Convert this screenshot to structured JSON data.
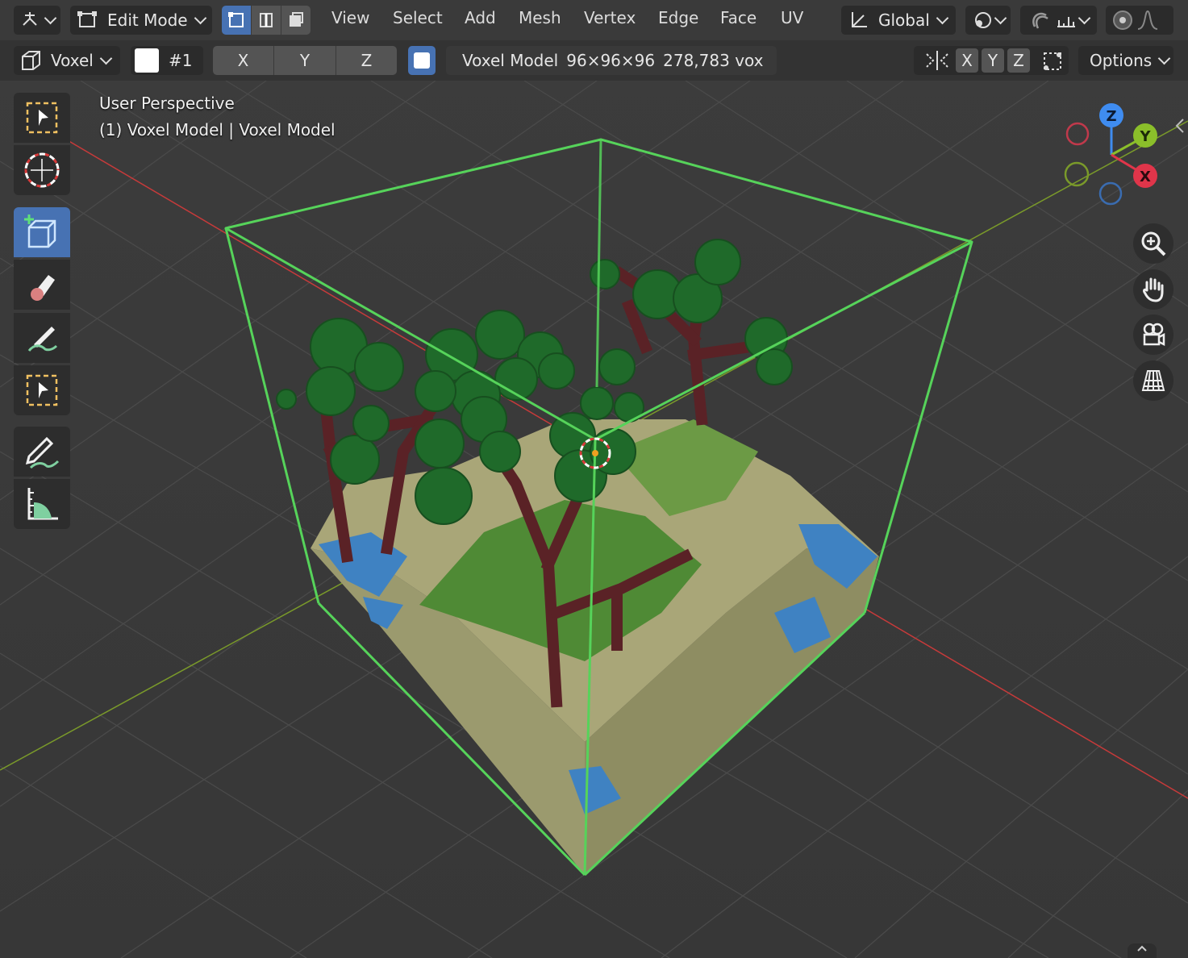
{
  "header": {
    "mode_label": "Edit Mode",
    "menus": [
      "View",
      "Select",
      "Add",
      "Mesh",
      "Vertex",
      "Edge",
      "Face",
      "UV"
    ],
    "orientation_label": "Global"
  },
  "tool_header": {
    "tool_label": "Voxel",
    "color_index": "#1",
    "axis_x": "X",
    "axis_y": "Y",
    "axis_z": "Z",
    "model_name": "Voxel Model",
    "model_dims": "96×96×96",
    "voxel_count": "278,783 vox",
    "mirror_x": "X",
    "mirror_y": "Y",
    "mirror_z": "Z",
    "options_label": "Options",
    "brush_color": "#ffffff"
  },
  "viewport": {
    "view_name": "User Perspective",
    "object_info": "(1) Voxel Model | Voxel Model"
  },
  "gizmo": {
    "z_label": "Z",
    "y_label": "Y",
    "x_label": "X"
  },
  "toolbar": {
    "tools": [
      "select-box-icon",
      "cursor-icon",
      "add-voxel-icon",
      "eraser-icon",
      "paint-brush-icon",
      "select-box-icon",
      "annotate-icon",
      "measure-icon"
    ],
    "active_tool": "add-voxel-icon"
  },
  "colors": {
    "accent": "#4772b3",
    "bounding_box": "#56d35a",
    "axis_x": "#c63a3a",
    "axis_y": "#7a9a2a"
  }
}
